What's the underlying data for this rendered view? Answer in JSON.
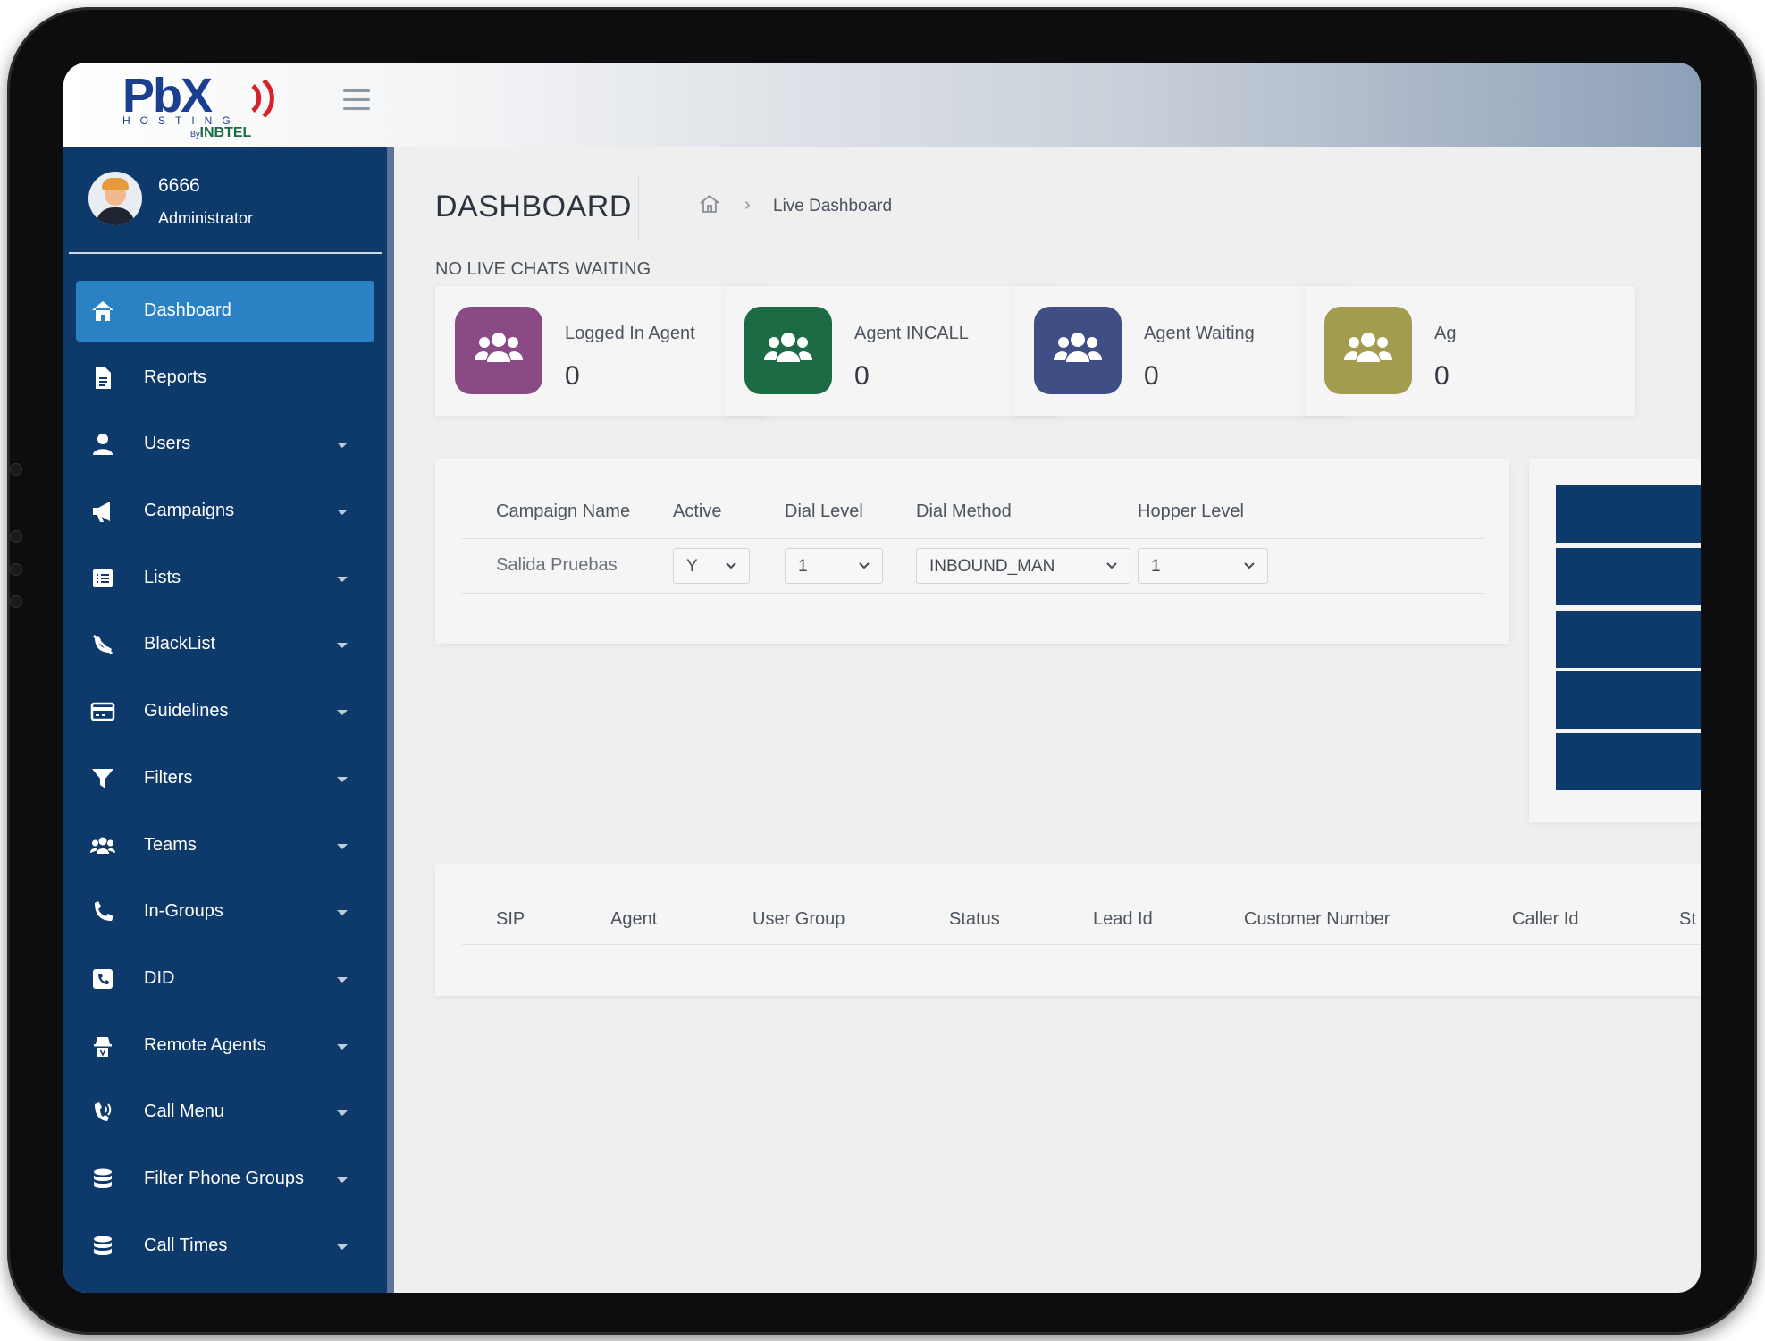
{
  "brand": {
    "logo_main": "PbX",
    "logo_sub": "HOSTING",
    "logo_by_prefix": "By",
    "logo_by_name": "INBTEL"
  },
  "user": {
    "name": "6666",
    "role": "Administrator"
  },
  "sidebar": {
    "items": [
      {
        "label": "Dashboard",
        "icon": "home-icon",
        "active": true,
        "has_caret": false
      },
      {
        "label": "Reports",
        "icon": "document-icon",
        "active": false,
        "has_caret": false
      },
      {
        "label": "Users",
        "icon": "user-icon",
        "active": false,
        "has_caret": true
      },
      {
        "label": "Campaigns",
        "icon": "megaphone-icon",
        "active": false,
        "has_caret": true
      },
      {
        "label": "Lists",
        "icon": "list-icon",
        "active": false,
        "has_caret": true
      },
      {
        "label": "BlackList",
        "icon": "blocked-phone-icon",
        "active": false,
        "has_caret": true
      },
      {
        "label": "Guidelines",
        "icon": "card-icon",
        "active": false,
        "has_caret": true
      },
      {
        "label": "Filters",
        "icon": "filter-icon",
        "active": false,
        "has_caret": true
      },
      {
        "label": "Teams",
        "icon": "team-icon",
        "active": false,
        "has_caret": true
      },
      {
        "label": "In-Groups",
        "icon": "phone-icon",
        "active": false,
        "has_caret": true
      },
      {
        "label": "DID",
        "icon": "phone-square-icon",
        "active": false,
        "has_caret": true
      },
      {
        "label": "Remote Agents",
        "icon": "agent-icon",
        "active": false,
        "has_caret": true
      },
      {
        "label": "Call Menu",
        "icon": "phone-volume-icon",
        "active": false,
        "has_caret": true
      },
      {
        "label": "Filter Phone Groups",
        "icon": "database-icon",
        "active": false,
        "has_caret": true
      },
      {
        "label": "Call Times",
        "icon": "database-icon",
        "active": false,
        "has_caret": true
      }
    ]
  },
  "page": {
    "title": "DASHBOARD",
    "breadcrumb_current": "Live Dashboard",
    "chat_status": "NO LIVE CHATS WAITING"
  },
  "stats": [
    {
      "label": "Logged In Agent",
      "value": "0",
      "color": "#8a4a85"
    },
    {
      "label": "Agent INCALL",
      "value": "0",
      "color": "#1d6b45"
    },
    {
      "label": "Agent Waiting",
      "value": "0",
      "color": "#3f4f86"
    },
    {
      "label": "Ag",
      "value": "0",
      "color": "#a39b4e"
    }
  ],
  "campaign_table": {
    "headers": [
      "Campaign Name",
      "Active",
      "Dial Level",
      "Dial Method",
      "Hopper Level"
    ],
    "row": {
      "campaign_name": "Salida Pruebas",
      "active": "Y",
      "dial_level": "1",
      "dial_method": "INBOUND_MAN",
      "hopper_level": "1"
    }
  },
  "agents_table": {
    "headers": [
      "SIP",
      "Agent",
      "User Group",
      "Status",
      "Lead Id",
      "Customer Number",
      "Caller Id",
      "St"
    ]
  },
  "colors": {
    "sidebar": "#0e3a6b",
    "active_item": "#2a82c5",
    "background": "#efeff0"
  }
}
